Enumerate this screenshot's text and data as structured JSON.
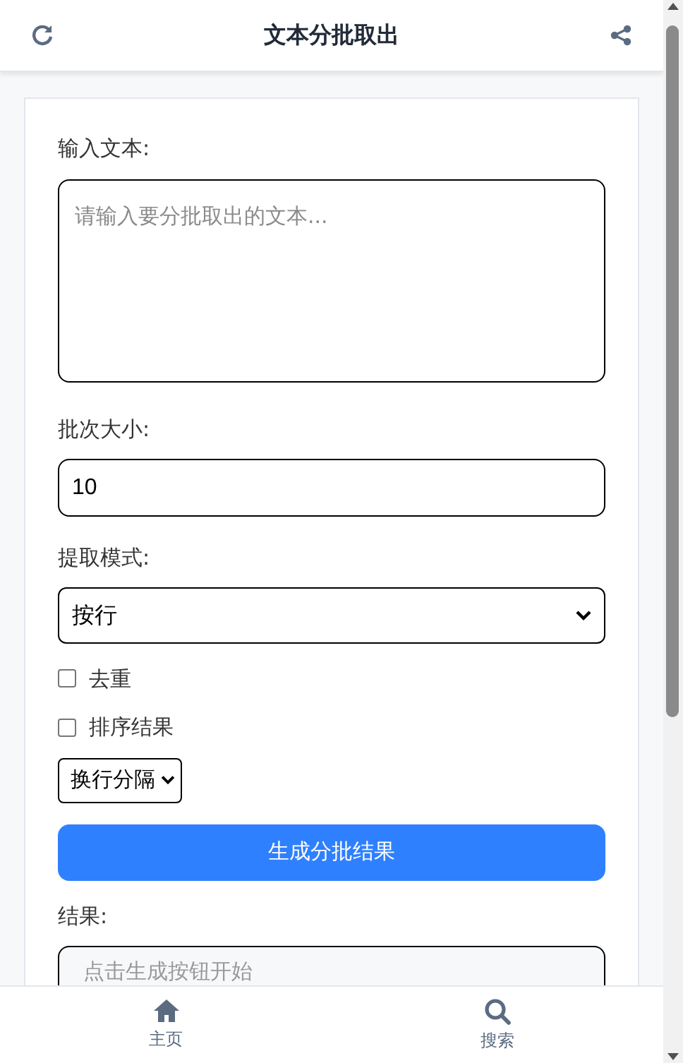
{
  "header": {
    "title": "文本分批取出"
  },
  "form": {
    "input_label": "输入文本:",
    "input_placeholder": "请输入要分批取出的文本...",
    "batch_label": "批次大小:",
    "batch_value": "10",
    "mode_label": "提取模式:",
    "mode_value": "按行",
    "options": [
      {
        "label": "去重",
        "checked": false
      },
      {
        "label": "排序结果",
        "checked": false
      }
    ],
    "separator_value": "换行分隔",
    "generate_button": "生成分批结果",
    "result_label": "结果:",
    "result_placeholder": "点击生成按钮开始"
  },
  "nav": [
    {
      "label": "主页",
      "kind": "home"
    },
    {
      "label": "搜索",
      "kind": "search"
    }
  ]
}
